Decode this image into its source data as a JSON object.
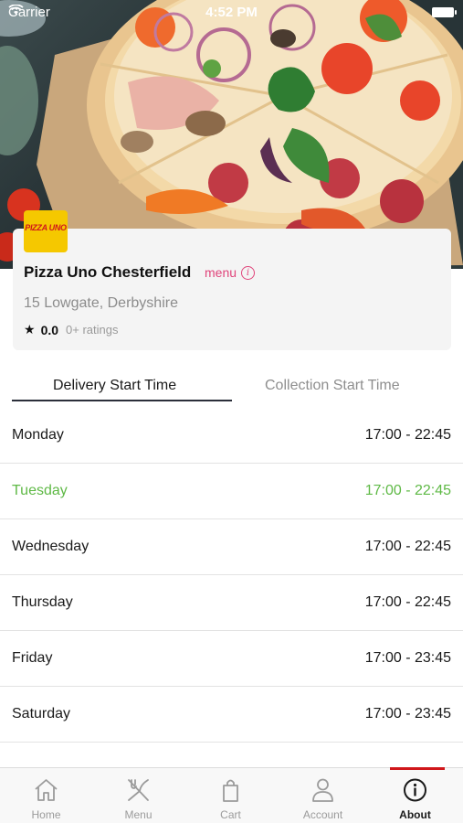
{
  "status_bar": {
    "carrier": "Carrier",
    "time": "4:52 PM"
  },
  "restaurant": {
    "logo_text": "PIZZA UNO",
    "name": "Pizza Uno Chesterfield",
    "menu_link": "menu",
    "address": "15 Lowgate, Derbyshire",
    "rating": "0.0",
    "ratings_count": "0+ ratings"
  },
  "tabs": [
    {
      "label": "Delivery Start Time",
      "active": true
    },
    {
      "label": "Collection Start Time",
      "active": false
    }
  ],
  "schedule": [
    {
      "day": "Monday",
      "hours": "17:00 - 22:45"
    },
    {
      "day": "Tuesday",
      "hours": "17:00 - 22:45",
      "today": true
    },
    {
      "day": "Wednesday",
      "hours": "17:00 - 22:45"
    },
    {
      "day": "Thursday",
      "hours": "17:00 - 22:45"
    },
    {
      "day": "Friday",
      "hours": "17:00 - 23:45"
    },
    {
      "day": "Saturday",
      "hours": "17:00 - 23:45"
    }
  ],
  "tabbar": [
    {
      "label": "Home",
      "icon": "home-icon"
    },
    {
      "label": "Menu",
      "icon": "fork-knife-icon"
    },
    {
      "label": "Cart",
      "icon": "bag-icon"
    },
    {
      "label": "Account",
      "icon": "person-icon"
    },
    {
      "label": "About",
      "icon": "info-icon",
      "active": true
    }
  ],
  "colors": {
    "accent_pink": "#e0457b",
    "today_green": "#5fb946",
    "brand_yellow": "#f5c800",
    "brand_red": "#d0171b"
  }
}
